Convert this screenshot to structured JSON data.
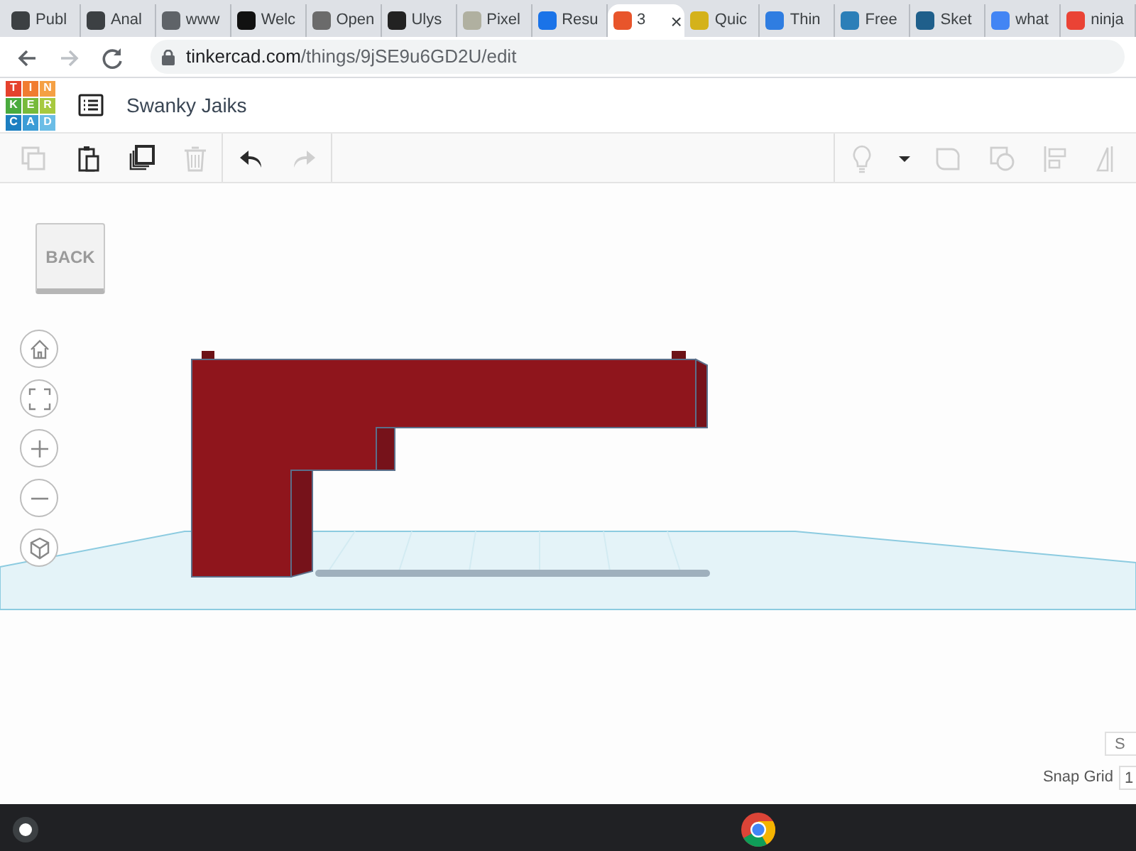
{
  "tabs": [
    {
      "title": "Publ",
      "selected": false,
      "color": "#3c4043"
    },
    {
      "title": "Anal",
      "selected": false,
      "color": "#3c4043"
    },
    {
      "title": "www",
      "selected": false,
      "color": "#5f6368"
    },
    {
      "title": "Welc",
      "selected": false,
      "color": "#111111"
    },
    {
      "title": "Open",
      "selected": false,
      "color": "#6b6b6b"
    },
    {
      "title": "Ulys",
      "selected": false,
      "color": "#222222"
    },
    {
      "title": "Pixel",
      "selected": false,
      "color": "#b0b0a0"
    },
    {
      "title": "Resu",
      "selected": false,
      "color": "#1a73e8"
    },
    {
      "title": "3",
      "selected": true,
      "color": "#e8552b"
    },
    {
      "title": "Quic",
      "selected": false,
      "color": "#d4b21a"
    },
    {
      "title": "Thin",
      "selected": false,
      "color": "#2f7de1"
    },
    {
      "title": "Free",
      "selected": false,
      "color": "#2c7fb8"
    },
    {
      "title": "Sket",
      "selected": false,
      "color": "#1f5f8b"
    },
    {
      "title": "what",
      "selected": false,
      "color": "#4285f4"
    },
    {
      "title": "ninja",
      "selected": false,
      "color": "#ea4335"
    }
  ],
  "close_tab": "×",
  "nav": [
    {
      "kind": "back",
      "disabled": false
    },
    {
      "kind": "forward",
      "disabled": true
    },
    {
      "kind": "reload",
      "disabled": false
    }
  ],
  "url": {
    "host": "tinkercad.com",
    "path": "/things/9jSE9u6GD2U/edit"
  },
  "logo": [
    {
      "letter": "T",
      "color": "#e5422d"
    },
    {
      "letter": "I",
      "color": "#f17c30"
    },
    {
      "letter": "N",
      "color": "#f5a044"
    },
    {
      "letter": "K",
      "color": "#4aab3e"
    },
    {
      "letter": "E",
      "color": "#77ba3a"
    },
    {
      "letter": "R",
      "color": "#a7c93f"
    },
    {
      "letter": "C",
      "color": "#1d7fc1"
    },
    {
      "letter": "A",
      "color": "#3b9cd6"
    },
    {
      "letter": "D",
      "color": "#6bbde6"
    }
  ],
  "title": "Swanky Jaiks",
  "tools_left": [
    {
      "kind": "copy",
      "disabled": true
    },
    {
      "kind": "paste",
      "disabled": false
    },
    {
      "kind": "duplicate",
      "disabled": false
    },
    {
      "kind": "delete",
      "disabled": true
    },
    {
      "kind": "sep"
    },
    {
      "kind": "undo",
      "disabled": false
    },
    {
      "kind": "redo",
      "disabled": true
    }
  ],
  "tools_right": [
    {
      "kind": "bulb",
      "disabled": true
    },
    {
      "kind": "caret",
      "disabled": false
    },
    {
      "kind": "group",
      "disabled": true
    },
    {
      "kind": "ungroup",
      "disabled": true
    },
    {
      "kind": "align",
      "disabled": true
    },
    {
      "kind": "mirror",
      "disabled": true
    }
  ],
  "back_button": "BACK",
  "view_buttons": [
    {
      "kind": "home"
    },
    {
      "kind": "fit"
    },
    {
      "kind": "zoom-in"
    },
    {
      "kind": "zoom-out"
    },
    {
      "kind": "cube"
    }
  ],
  "settings_button": "S",
  "snap_grid": {
    "label": "Snap Grid",
    "value": "1"
  }
}
